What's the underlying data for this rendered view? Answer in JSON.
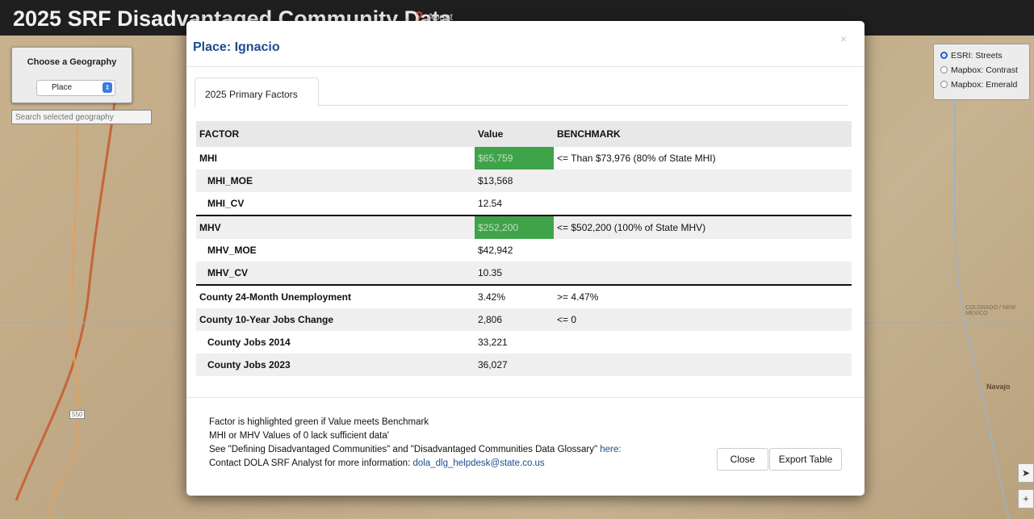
{
  "app": {
    "title": "2025 SRF Disadvantaged Community Data",
    "about_label": "About"
  },
  "geography_panel": {
    "title": "Choose a Geography",
    "selected": "Place"
  },
  "search": {
    "placeholder": "Search selected geography"
  },
  "basemaps": [
    {
      "label": "ESRI: Streets",
      "selected": true
    },
    {
      "label": "Mapbox: Contrast",
      "selected": false
    },
    {
      "label": "Mapbox: Emerald",
      "selected": false
    }
  ],
  "map_labels": {
    "state_line": "COLORADO / NEW MEXICO",
    "navajo": "Navajo",
    "road": "550"
  },
  "map_controls": {
    "locate": "➤",
    "zoom_in": "+"
  },
  "modal": {
    "title": "Place: Ignacio",
    "close_icon": "×",
    "tab": "2025 Primary Factors",
    "table": {
      "headers": [
        "FACTOR",
        "Value",
        "BENCHMARK"
      ],
      "rows": [
        {
          "factor": "MHI",
          "value": "$65,759",
          "benchmark": "<= Than $73,976 (80% of State MHI)",
          "highlight": true
        },
        {
          "factor": "MHI_MOE",
          "value": "$13,568",
          "benchmark": ""
        },
        {
          "factor": "MHI_CV",
          "value": "12.54",
          "benchmark": ""
        },
        {
          "factor": "MHV",
          "value": "$252,200",
          "benchmark": "<= $502,200 (100% of State MHV)",
          "highlight": true
        },
        {
          "factor": "MHV_MOE",
          "value": "$42,942",
          "benchmark": ""
        },
        {
          "factor": "MHV_CV",
          "value": "10.35",
          "benchmark": ""
        },
        {
          "factor": "County 24-Month Unemployment",
          "value": "3.42%",
          "benchmark": ">= 4.47%"
        },
        {
          "factor": "County 10-Year Jobs Change",
          "value": "2,806",
          "benchmark": "<= 0"
        },
        {
          "factor": "County Jobs 2014",
          "value": "33,221",
          "benchmark": ""
        },
        {
          "factor": "County Jobs 2023",
          "value": "36,027",
          "benchmark": ""
        }
      ]
    },
    "notes": {
      "line1": "Factor is highlighted green if Value meets Benchmark",
      "line2": "MHI or MHV Values of 0 lack sufficient data'",
      "line3": "See \"Defining Disadvantaged Communities\" and \"Disadvantaged Communities Data Glossary\"",
      "line3_link": "here:",
      "line4": "Contact DOLA SRF Analyst for more information:",
      "line4_email": "dola_dlg_helpdesk@state.co.us"
    },
    "buttons": {
      "close": "Close",
      "export": "Export Table"
    }
  },
  "colors": {
    "highlight": "#3fa34a",
    "title": "#1d4b8f",
    "topbar": "#1f1f1f"
  }
}
